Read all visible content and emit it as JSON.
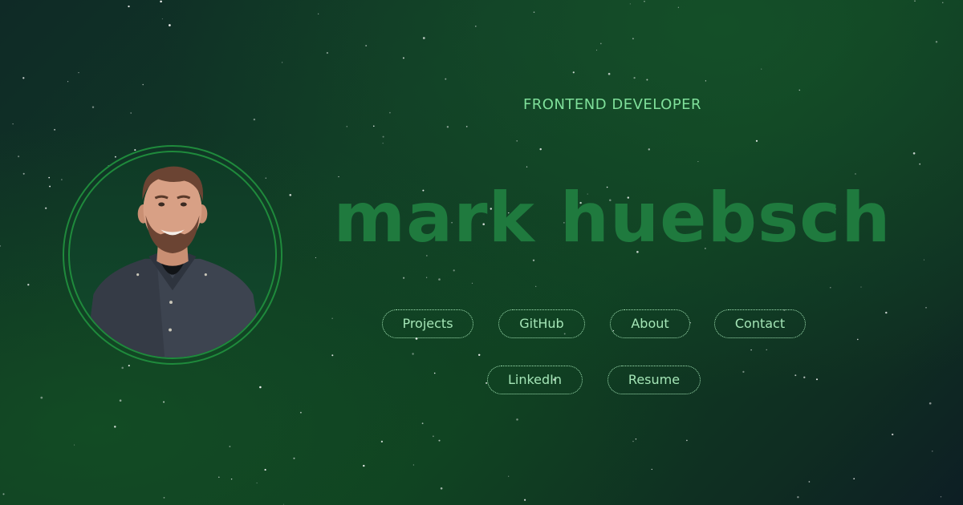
{
  "hero": {
    "subtitle": "FRONTEND DEVELOPER",
    "name": "mark huebsch"
  },
  "nav": {
    "projects": "Projects",
    "github": "GitHub",
    "about": "About",
    "contact": "Contact",
    "linkedin": "LinkedIn",
    "resume": "Resume"
  },
  "colors": {
    "accent": "#1f7a3e",
    "text_light": "#a4e5b6",
    "subtitle": "#7fe09a",
    "ring": "#1f8a3c"
  }
}
